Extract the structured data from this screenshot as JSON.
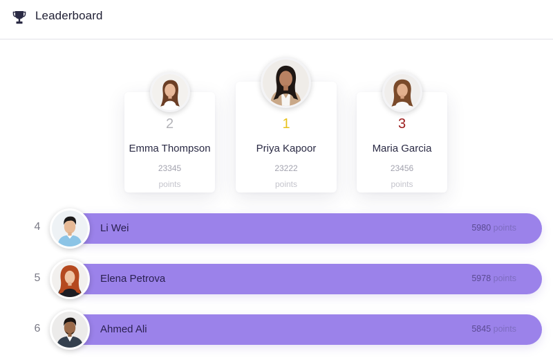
{
  "header": {
    "title": "Leaderboard",
    "icon": "trophy-icon"
  },
  "podium": [
    {
      "rank": "2",
      "name": "Emma Thompson",
      "score": "23345",
      "unit": "points",
      "rank_color": "#b3b3b8"
    },
    {
      "rank": "1",
      "name": "Priya Kapoor",
      "score": "23222",
      "unit": "points",
      "rank_color": "#e8c21a"
    },
    {
      "rank": "3",
      "name": "Maria Garcia",
      "score": "23456",
      "unit": "points",
      "rank_color": "#9b1b1b"
    }
  ],
  "list": [
    {
      "rank": "4",
      "name": "Li Wei",
      "score": "5980",
      "unit": "points"
    },
    {
      "rank": "5",
      "name": "Elena Petrova",
      "score": "5978",
      "unit": "points"
    },
    {
      "rank": "6",
      "name": "Ahmed Ali",
      "score": "5845",
      "unit": "points"
    }
  ],
  "colors": {
    "bar": "#9b82ea",
    "accent_text": "#2a2050"
  }
}
